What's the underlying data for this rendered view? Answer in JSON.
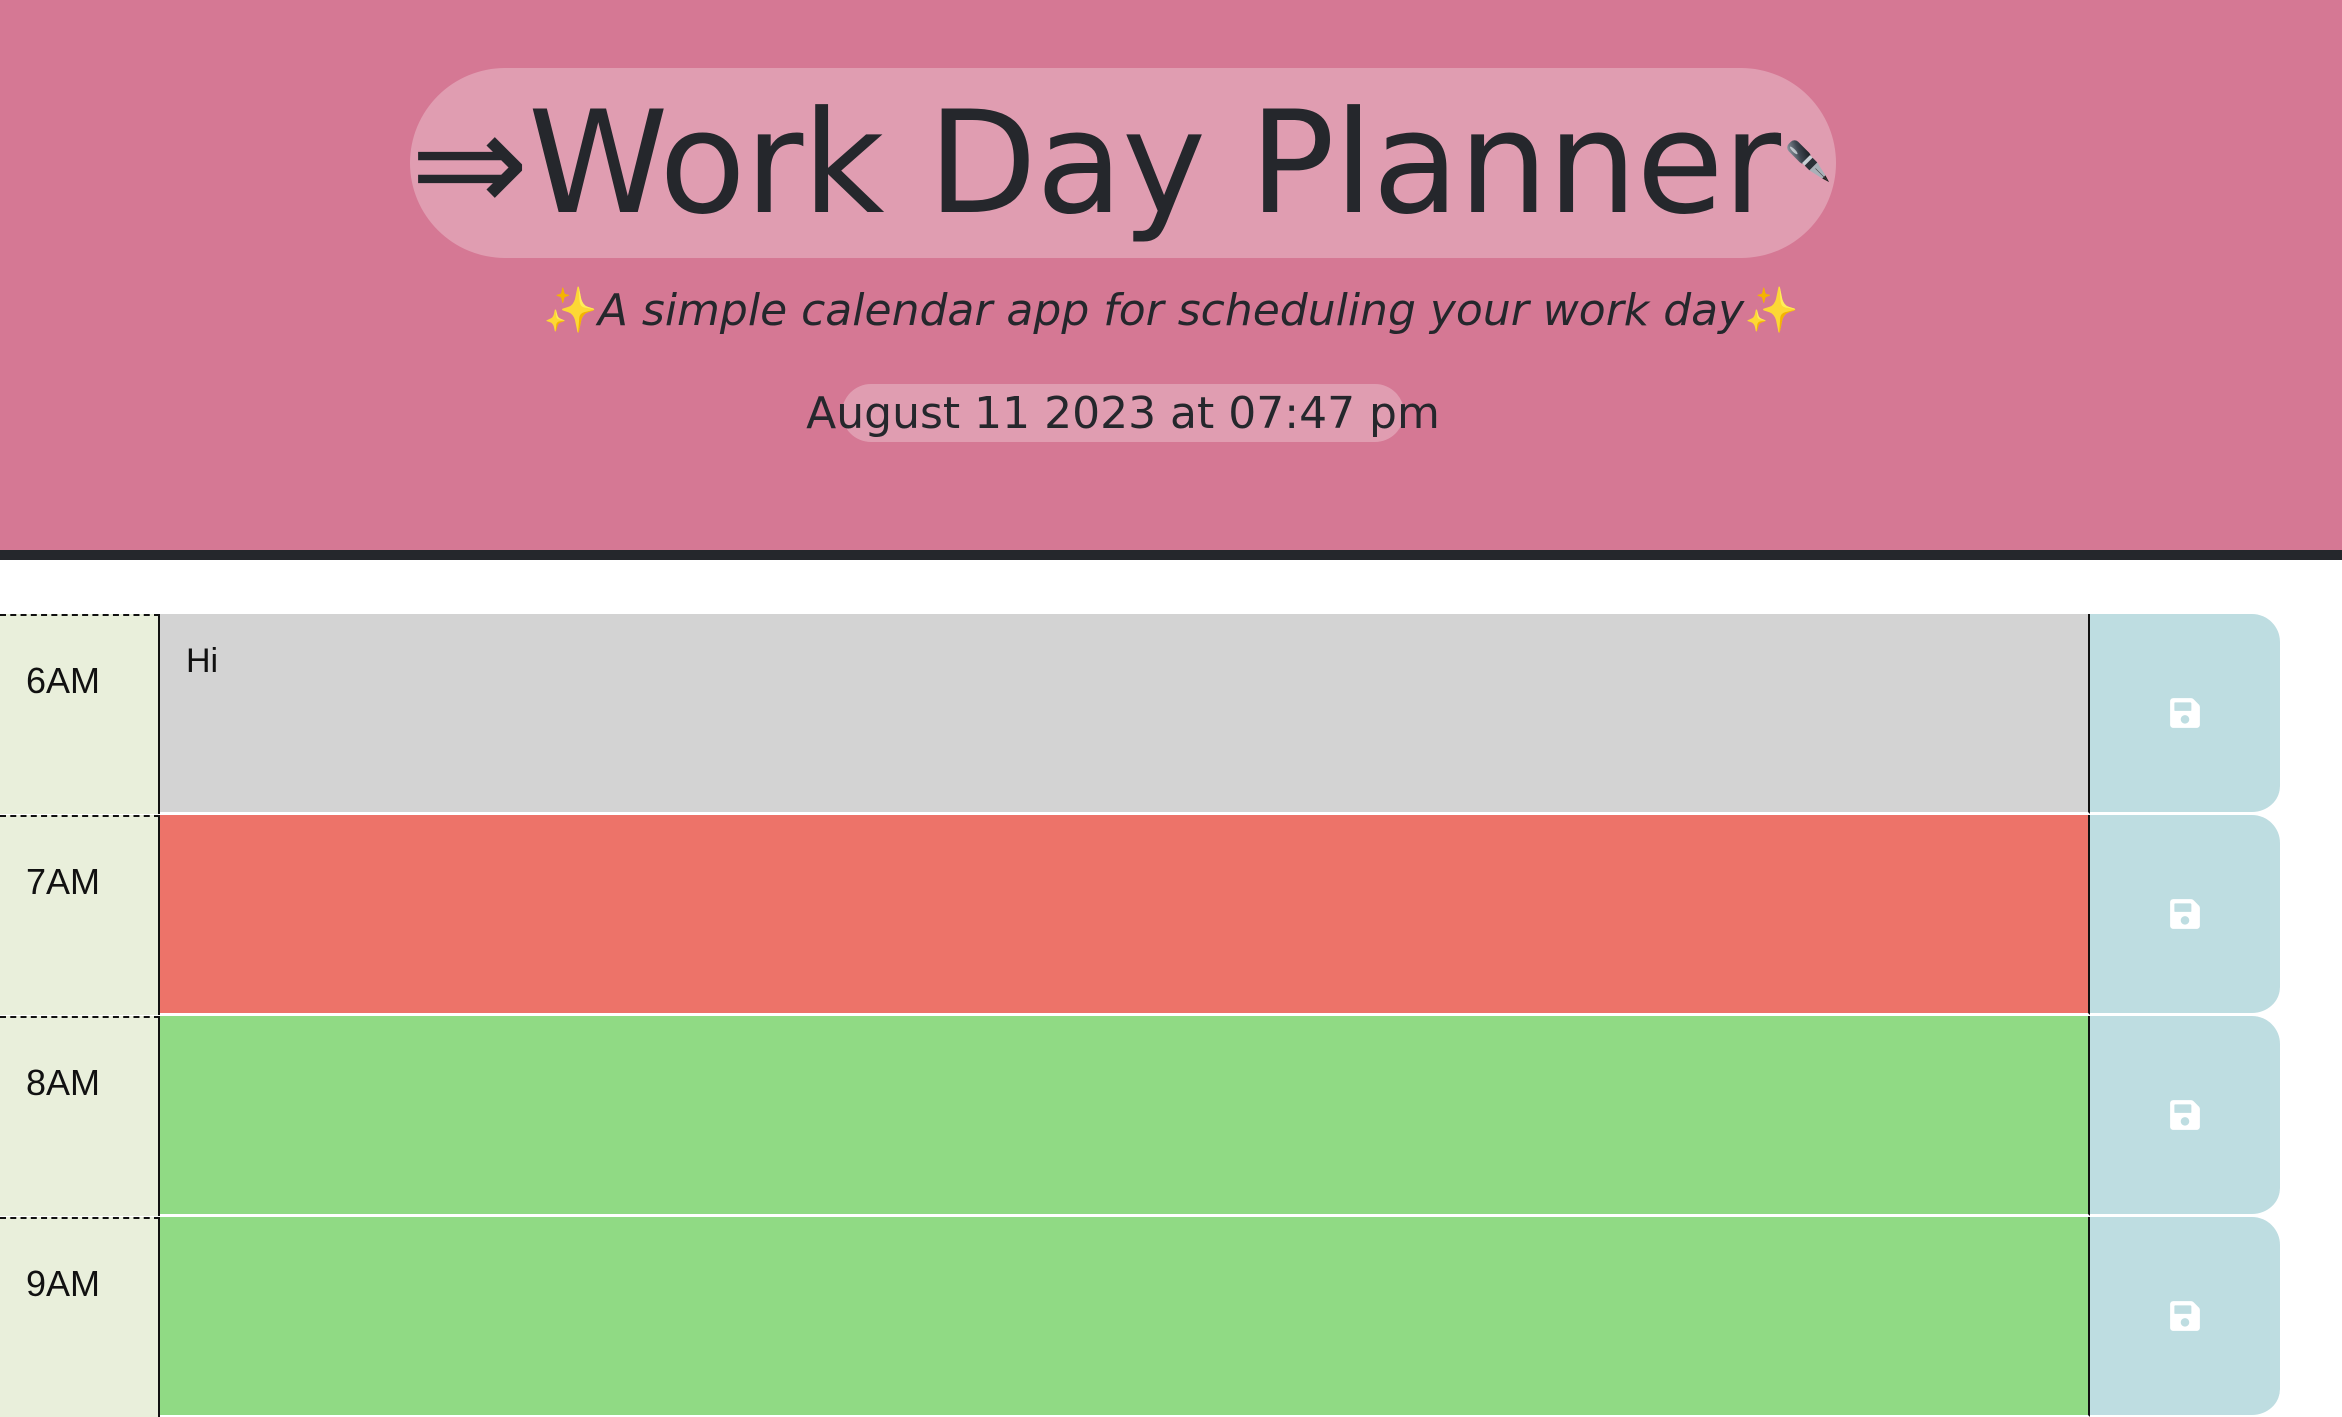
{
  "header": {
    "arrow": "⇒",
    "title": "Work Day Planner",
    "pen_emoji": "🖋️",
    "sparkle": "✨",
    "subtitle": "A simple calendar app for scheduling your work day",
    "current_date": "August 11 2023 at 07:47 pm"
  },
  "colors": {
    "header_bg": "#d57894",
    "past": "#d3d3d3",
    "present": "#ed7369",
    "future": "#90da84",
    "hour_bg": "#e9efdb",
    "save_bg": "#bedde1"
  },
  "timeblocks": [
    {
      "hour": "6AM",
      "text": "Hi",
      "state": "past",
      "save_icon": "save-icon"
    },
    {
      "hour": "7AM",
      "text": "",
      "state": "present",
      "save_icon": "save-icon"
    },
    {
      "hour": "8AM",
      "text": "",
      "state": "future",
      "save_icon": "save-icon"
    },
    {
      "hour": "9AM",
      "text": "",
      "state": "future",
      "save_icon": "save-icon"
    }
  ]
}
